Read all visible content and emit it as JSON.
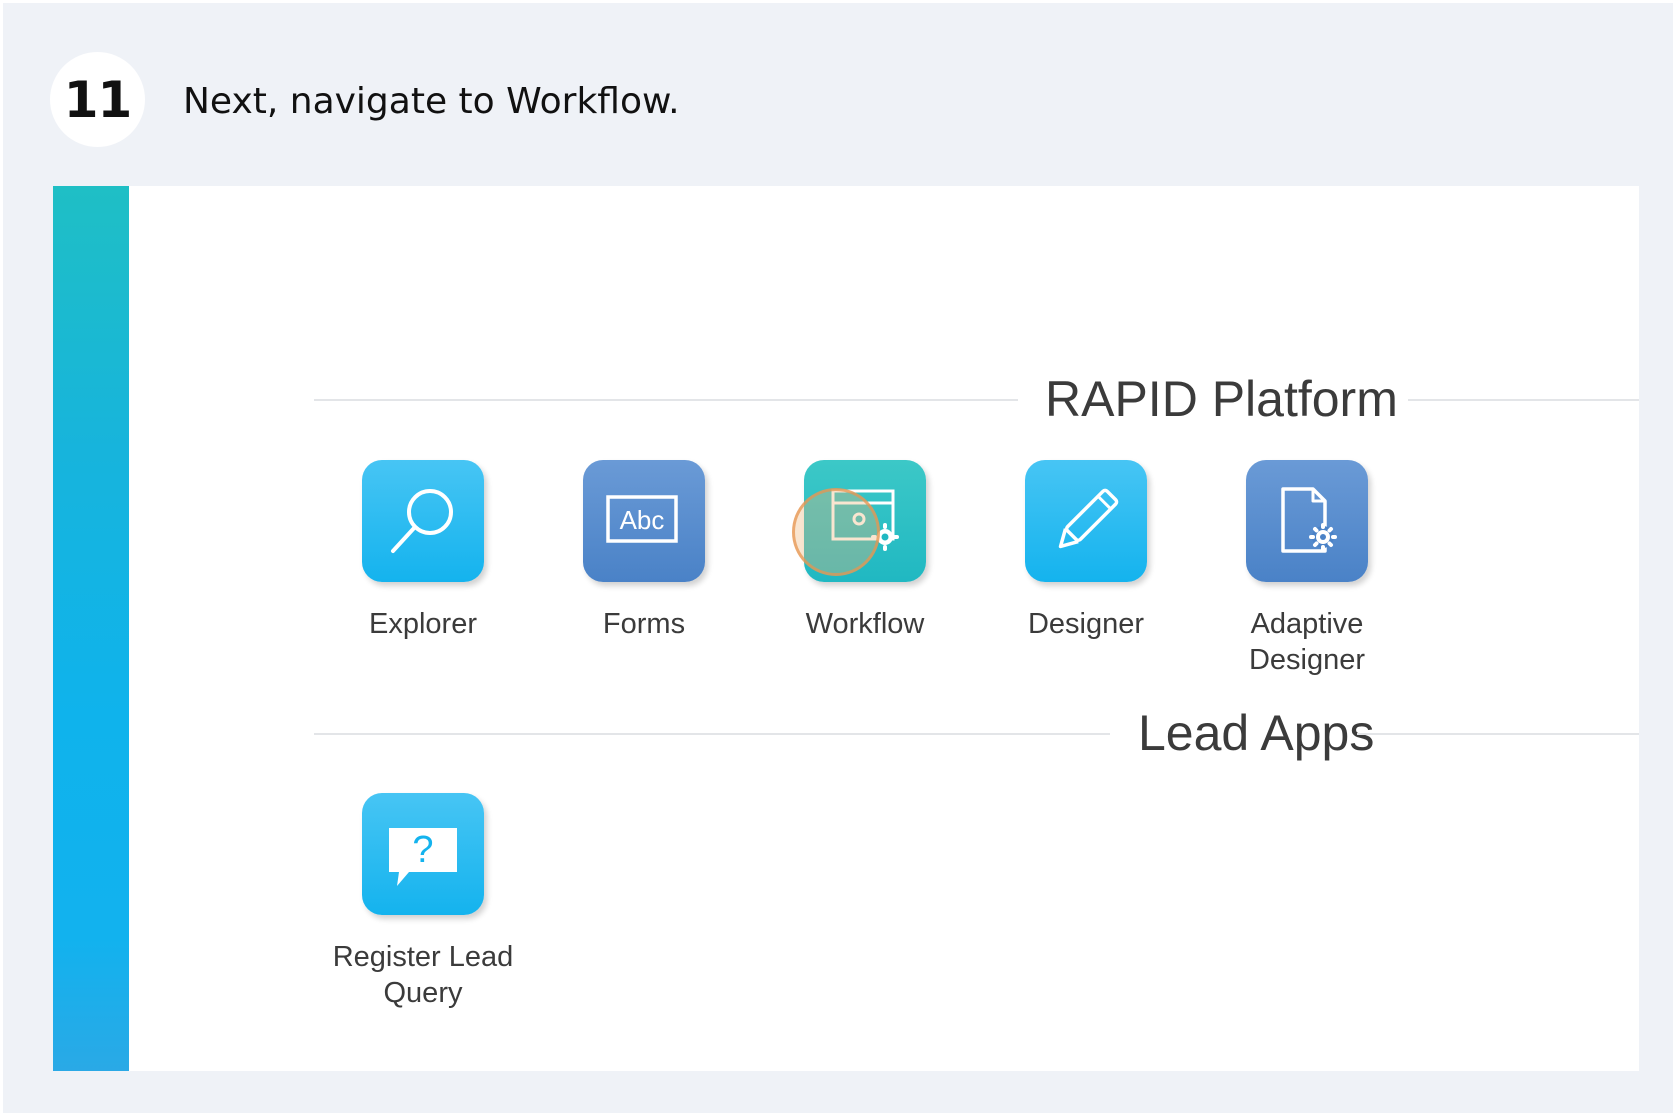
{
  "step": {
    "number": "11",
    "instruction": "Next, navigate to Workflow."
  },
  "sections": {
    "platform": {
      "title": "RAPID Platform"
    },
    "lead": {
      "title": "Lead Apps"
    }
  },
  "apps": {
    "explorer": {
      "label": "Explorer",
      "icon": "search-icon",
      "color": "#14b3ee"
    },
    "forms": {
      "label": "Forms",
      "icon": "abc-form-icon",
      "color": "#4a82c7",
      "icon_text": "Abc"
    },
    "workflow": {
      "label": "Workflow",
      "icon": "workflow-gear-icon",
      "color": "#20b8c2"
    },
    "designer": {
      "label": "Designer",
      "icon": "pencil-icon",
      "color": "#14b3ee"
    },
    "adaptive_designer": {
      "label_line1": "Adaptive",
      "label_line2": "Designer",
      "icon": "document-gear-icon",
      "color": "#4a82c7"
    },
    "register_lead_query": {
      "label_line1": "Register Lead",
      "label_line2": "Query",
      "icon": "question-bubble-icon",
      "color": "#14b3ee",
      "icon_text": "?"
    }
  },
  "colors": {
    "sidebar_top": "#1fbfc5",
    "sidebar_bottom": "#2aa9e6",
    "click_marker": "#e69650"
  }
}
